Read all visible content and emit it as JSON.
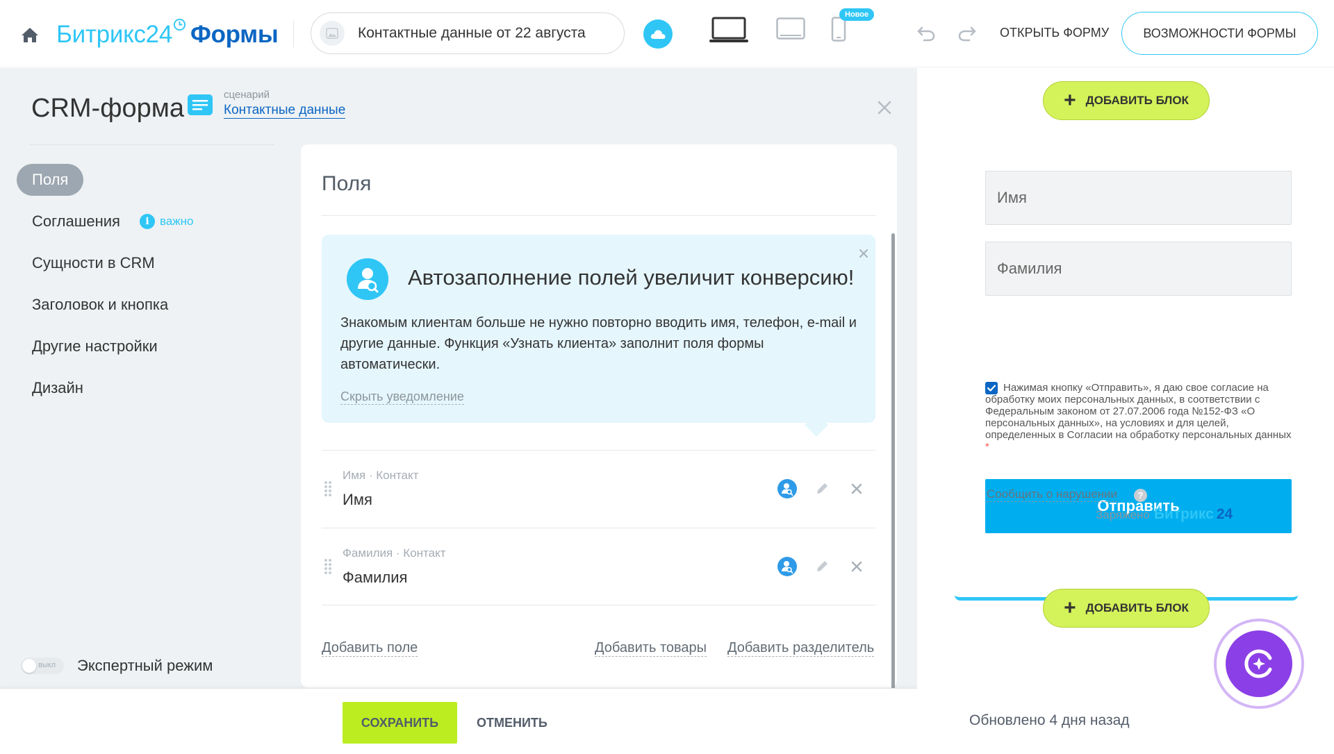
{
  "header": {
    "logo_part1": "Битрикс24",
    "logo_part2": "Формы",
    "form_title": "Контактные данные от 22 августа",
    "new_badge": "Новое",
    "open_form": "ОТКРЫТЬ ФОРМУ",
    "features": "ВОЗМОЖНОСТИ ФОРМЫ"
  },
  "sidebar": {
    "title": "CRM-форма",
    "scenario_label": "сценарий",
    "scenario_value": "Контактные данные",
    "items": [
      {
        "label": "Поля"
      },
      {
        "label": "Соглашения",
        "badge": "важно"
      },
      {
        "label": "Сущности в CRM"
      },
      {
        "label": "Заголовок и кнопка"
      },
      {
        "label": "Другие настройки"
      },
      {
        "label": "Дизайн"
      }
    ],
    "expert_toggle_state": "выкл",
    "expert_label": "Экспертный режим"
  },
  "fields_panel": {
    "title": "Поля",
    "notice": {
      "title": "Автозаполнение полей увеличит конверсию!",
      "text": "Знакомым клиентам больше не нужно повторно вводить имя, телефон, e-mail и другие данные. Функция «Узнать клиента» заполнит поля формы автоматически.",
      "hide_link": "Скрыть уведомление"
    },
    "fields": [
      {
        "meta": "Имя · Контакт",
        "name": "Имя"
      },
      {
        "meta": "Фамилия · Контакт",
        "name": "Фамилия"
      }
    ],
    "add_field": "Добавить поле",
    "add_products": "Добавить товары",
    "add_divider": "Добавить разделитель"
  },
  "footer": {
    "save": "СОХРАНИТЬ",
    "cancel": "ОТМЕНИТЬ"
  },
  "preview": {
    "add_block": "ДОБАВИТЬ БЛОК",
    "input_first_name": "Имя",
    "input_last_name": "Фамилия",
    "consent_text": "Нажимая кнопку «Отправить», я даю свое согласие на обработку моих персональных данных, в соответствии с Федеральным законом от 27.07.2006 года №152-ФЗ «О персональных данных», на условиях и для целей, определенных в Согласии на обработку персональных данных",
    "consent_required_mark": "*",
    "submit": "Отправить",
    "report": "Сообщить о нарушении",
    "powered_label": "Заряжено",
    "powered_brand1": "Битрикс",
    "powered_brand2": "24",
    "updated": "Обновлено 4 дня назад"
  },
  "colors": {
    "accent": "#2fc6f6",
    "brand_blue": "#0b66c3",
    "save_green": "#bbed21",
    "add_block_green": "#d4f25a",
    "submit_blue": "#00aeef",
    "assistant_purple": "#8b3fe6"
  },
  "icons": {
    "home": "home-icon",
    "cloud": "cloud-icon",
    "laptop": "laptop-icon",
    "tablet": "tablet-icon",
    "phone": "phone-icon",
    "undo": "undo-icon",
    "redo": "redo-icon",
    "close": "close-icon",
    "autofill": "user-search-icon",
    "edit": "pencil-icon",
    "delete": "close-icon",
    "drag": "drag-handle-icon",
    "assistant": "ai-assistant-icon"
  }
}
